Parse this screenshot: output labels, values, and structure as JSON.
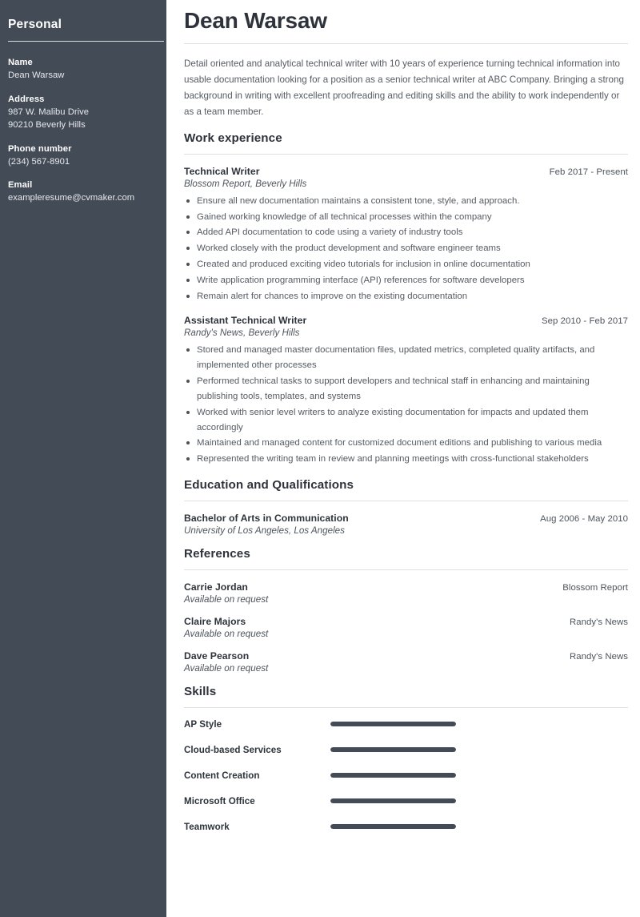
{
  "sidebar": {
    "title": "Personal",
    "groups": [
      {
        "label": "Name",
        "value": "Dean Warsaw"
      },
      {
        "label": "Address",
        "value": "987 W. Malibu Drive\n90210 Beverly Hills"
      },
      {
        "label": "Phone number",
        "value": "(234) 567-8901"
      },
      {
        "label": "Email",
        "value": "exampleresume@cvmaker.com"
      }
    ]
  },
  "header": {
    "full_name": "Dean Warsaw",
    "summary": "Detail oriented and analytical technical writer with 10 years of experience turning technical information into usable documentation looking for a position as a senior technical writer at ABC Company. Bringing a strong background in writing with excellent proofreading and editing skills and the ability to work independently or as a team member."
  },
  "sections": {
    "work": {
      "heading": "Work experience",
      "entries": [
        {
          "title": "Technical Writer",
          "date": "Feb 2017 - Present",
          "subtitle": "Blossom Report, Beverly Hills",
          "bullets": [
            "Ensure all new documentation maintains a consistent tone, style, and approach.",
            "Gained working knowledge of all technical processes within the company",
            "Added API documentation to code using a variety of industry tools",
            "Worked closely with the product development and software engineer teams",
            "Created and produced exciting video tutorials for inclusion in online documentation",
            "Write application programming interface (API) references for software developers",
            "Remain alert for chances to improve on the existing documentation"
          ]
        },
        {
          "title": "Assistant Technical Writer",
          "date": "Sep 2010 - Feb 2017",
          "subtitle": "Randy's News, Beverly Hills",
          "bullets": [
            "Stored and managed master documentation files, updated metrics, completed quality artifacts, and implemented other processes",
            "Performed technical tasks to support developers and technical staff in enhancing and maintaining publishing tools, templates, and systems",
            "Worked with senior level writers to analyze existing documentation for impacts and updated them accordingly",
            "Maintained and managed content for customized document editions and publishing to various media",
            "Represented the writing team in review and planning meetings with cross-functional stakeholders"
          ]
        }
      ]
    },
    "education": {
      "heading": "Education and Qualifications",
      "entries": [
        {
          "title": "Bachelor of Arts in Communication",
          "date": "Aug 2006 - May 2010",
          "subtitle": "University of Los Angeles, Los Angeles"
        }
      ]
    },
    "references": {
      "heading": "References",
      "entries": [
        {
          "title": "Carrie Jordan",
          "date": "Blossom Report",
          "subtitle": "Available on request"
        },
        {
          "title": "Claire Majors",
          "date": "Randy's News",
          "subtitle": "Available on request"
        },
        {
          "title": "Dave Pearson",
          "date": "Randy's News",
          "subtitle": "Available on request"
        }
      ]
    },
    "skills": {
      "heading": "Skills",
      "items": [
        {
          "name": "AP Style",
          "level": 100
        },
        {
          "name": "Cloud-based Services",
          "level": 100
        },
        {
          "name": "Content Creation",
          "level": 100
        },
        {
          "name": "Microsoft Office",
          "level": 100
        },
        {
          "name": "Teamwork",
          "level": 100
        }
      ]
    }
  },
  "colors": {
    "sidebar_bg": "#434b57",
    "heading": "#2e333b",
    "body_text": "#555b62",
    "rule": "#dedfe1",
    "skill_bar": "#434b57"
  }
}
